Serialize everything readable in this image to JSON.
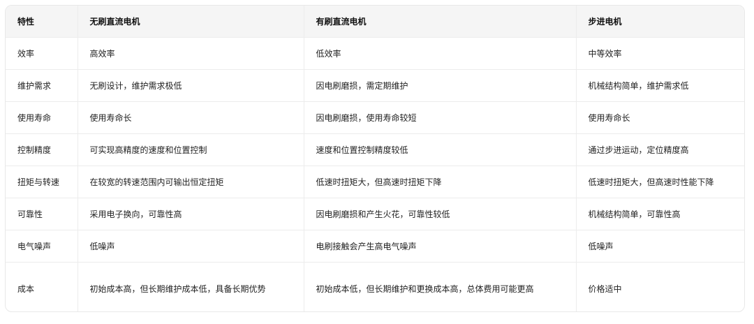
{
  "table": {
    "headers": [
      "特性",
      "无刷直流电机",
      "有刷直流电机",
      "步进电机"
    ],
    "rows": [
      [
        "效率",
        "高效率",
        "低效率",
        "中等效率"
      ],
      [
        "维护需求",
        "无刷设计，维护需求极低",
        "因电刷磨损，需定期维护",
        "机械结构简单，维护需求低"
      ],
      [
        "使用寿命",
        "使用寿命长",
        "因电刷磨损，使用寿命较短",
        "使用寿命长"
      ],
      [
        "控制精度",
        "可实现高精度的速度和位置控制",
        "速度和位置控制精度较低",
        "通过步进运动，定位精度高"
      ],
      [
        "扭矩与转速",
        "在较宽的转速范围内可输出恒定扭矩",
        "低速时扭矩大，但高速时扭矩下降",
        "低速时扭矩大，但高速时性能下降"
      ],
      [
        "可靠性",
        "采用电子换向，可靠性高",
        "因电刷磨损和产生火花，可靠性较低",
        "机械结构简单，可靠性高"
      ],
      [
        "电气噪声",
        "低噪声",
        "电刷接触会产生高电气噪声",
        "低噪声"
      ],
      [
        "成本",
        "初始成本高，但长期维护成本低，具备长期优势",
        "初始成本低，但长期维护和更换成本高，总体费用可能更高",
        "价格适中"
      ]
    ]
  }
}
